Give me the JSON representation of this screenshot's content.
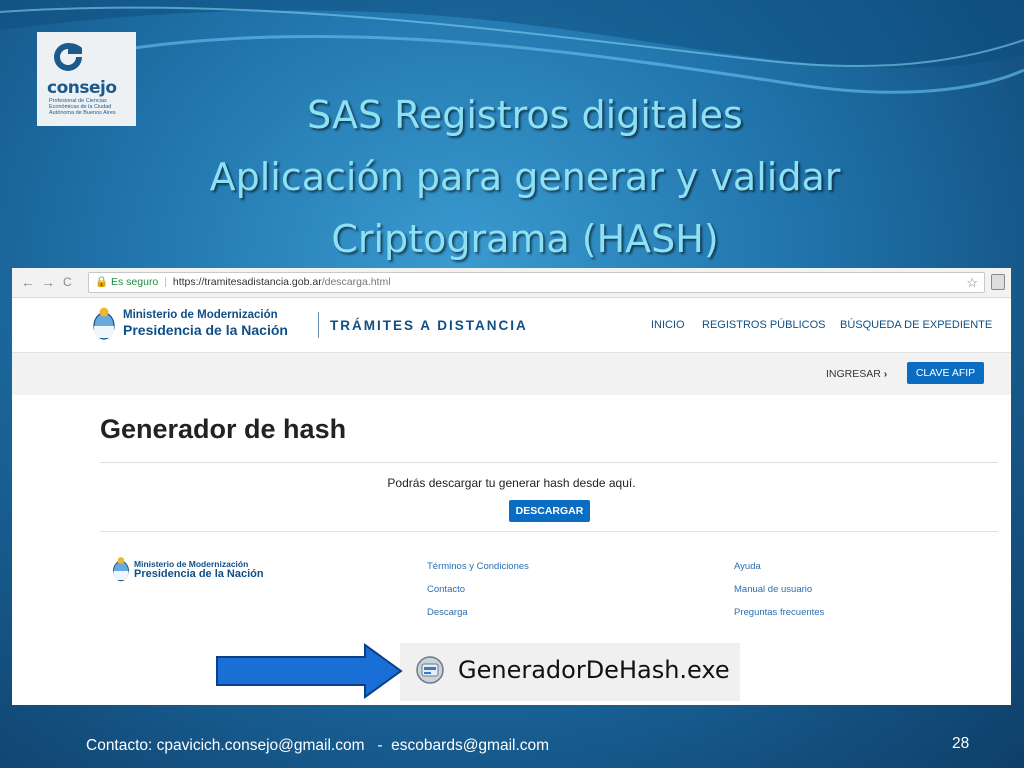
{
  "slide": {
    "title_lines": [
      "SAS Registros digitales",
      "Aplicación para generar y validar",
      "Criptograma (HASH)"
    ],
    "footer": "Contacto: cpavicich.consejo@gmail.com   -  escobards@gmail.com",
    "page_number": "28",
    "logo": {
      "word": "consejo",
      "subtitle": "Profesional de Ciencias Económicas de la Ciudad Autónoma de Buenos Aires"
    }
  },
  "browser": {
    "back": "←",
    "forward": "→",
    "reload": "C",
    "secure_label": "Es seguro",
    "url_host": "https://tramitesadistancia.gob.ar",
    "url_path": "/descarga.html"
  },
  "site": {
    "ministry_line1": "Ministerio de Modernización",
    "ministry_line2": "Presidencia de la Nación",
    "brand": "TRÁMITES A DISTANCIA",
    "nav": [
      "INICIO",
      "REGISTROS PÚBLICOS",
      "BÚSQUEDA DE EXPEDIENTE"
    ],
    "ingresar": "INGRESAR",
    "clave_afip": "CLAVE AFIP",
    "heading": "Generador de hash",
    "description": "Podrás descargar tu generar hash desde aquí.",
    "download_button": "DESCARGAR",
    "footer_col1": [
      "Términos y Condiciones",
      "Contacto",
      "Descarga"
    ],
    "footer_col2": [
      "Ayuda",
      "Manual de usuario",
      "Preguntas frecuentes"
    ]
  },
  "file": {
    "name": "GeneradorDeHash.exe"
  },
  "colors": {
    "accent_blue": "#0a6dc2",
    "title_cyan": "#8ee0f3",
    "arrow_blue": "#1a6fd6"
  }
}
